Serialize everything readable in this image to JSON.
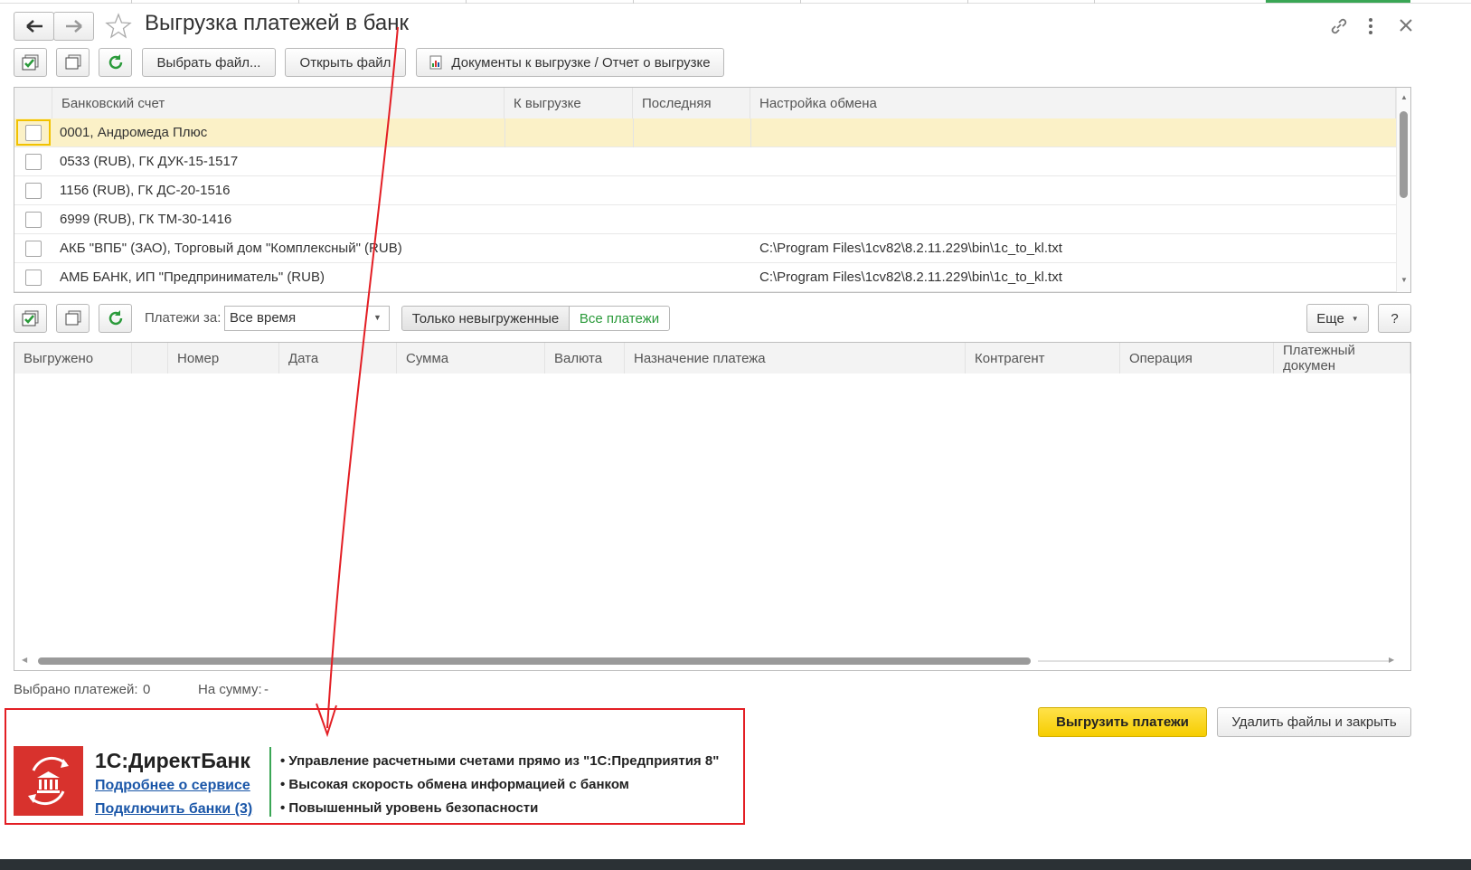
{
  "window": {
    "title": "Выгрузка платежей в банк"
  },
  "toolbar1": {
    "choose_file": "Выбрать файл...",
    "open_file": "Открыть файл",
    "docs_report": "Документы к выгрузке / Отчет о выгрузке"
  },
  "accounts_table": {
    "headers": [
      "Банковский счет",
      "К выгрузке",
      "Последняя",
      "Настройка обмена"
    ],
    "rows": [
      {
        "account": "0001, Андромеда Плюс",
        "to_export": "",
        "last": "",
        "exchange": "",
        "selected": true
      },
      {
        "account": "0533 (RUB), ГК ДУК-15-1517",
        "to_export": "",
        "last": "",
        "exchange": ""
      },
      {
        "account": "1156 (RUB), ГК ДС-20-1516",
        "to_export": "",
        "last": "",
        "exchange": ""
      },
      {
        "account": "6999 (RUB), ГК ТМ-30-1416",
        "to_export": "",
        "last": "",
        "exchange": ""
      },
      {
        "account": "АКБ \"ВПБ\" (ЗАО), Торговый дом \"Комплексный\" (RUB)",
        "to_export": "",
        "last": "",
        "exchange": "C:\\Program Files\\1cv82\\8.2.11.229\\bin\\1c_to_kl.txt"
      },
      {
        "account": "АМБ БАНК, ИП \"Предприниматель\" (RUB)",
        "to_export": "",
        "last": "",
        "exchange": "C:\\Program Files\\1cv82\\8.2.11.229\\bin\\1c_to_kl.txt"
      }
    ]
  },
  "toolbar2": {
    "period_label": "Платежи за:",
    "period_value": "Все время",
    "only_unexported": "Только невыгруженные",
    "all_payments": "Все платежи",
    "more": "Еще",
    "help": "?"
  },
  "payments_table": {
    "headers": [
      "Выгружено",
      "",
      "Номер",
      "Дата",
      "Сумма",
      "Валюта",
      "Назначение платежа",
      "Контрагент",
      "Операция",
      "Платежный докумен"
    ]
  },
  "footer": {
    "selected_label": "Выбрано платежей:",
    "selected_value": "0",
    "sum_label": "На сумму:",
    "sum_value": "-",
    "export_button": "Выгрузить платежи",
    "delete_close_button": "Удалить файлы и закрыть"
  },
  "promo": {
    "title": "1С:ДиректБанк",
    "link_more": "Подробнее о сервисе",
    "link_connect": "Подключить банки (3)",
    "bullets": [
      "• Управление расчетными счетами прямо из \"1С:Предприятия 8\"",
      "• Высокая скорость обмена информацией с банком",
      "• Повышенный уровень безопасности"
    ]
  },
  "colors": {
    "accent_yellow": "#ffd50f",
    "promo_red": "#d8322d",
    "annotation_red": "#e31e24",
    "green_active": "#2a9a3a"
  }
}
